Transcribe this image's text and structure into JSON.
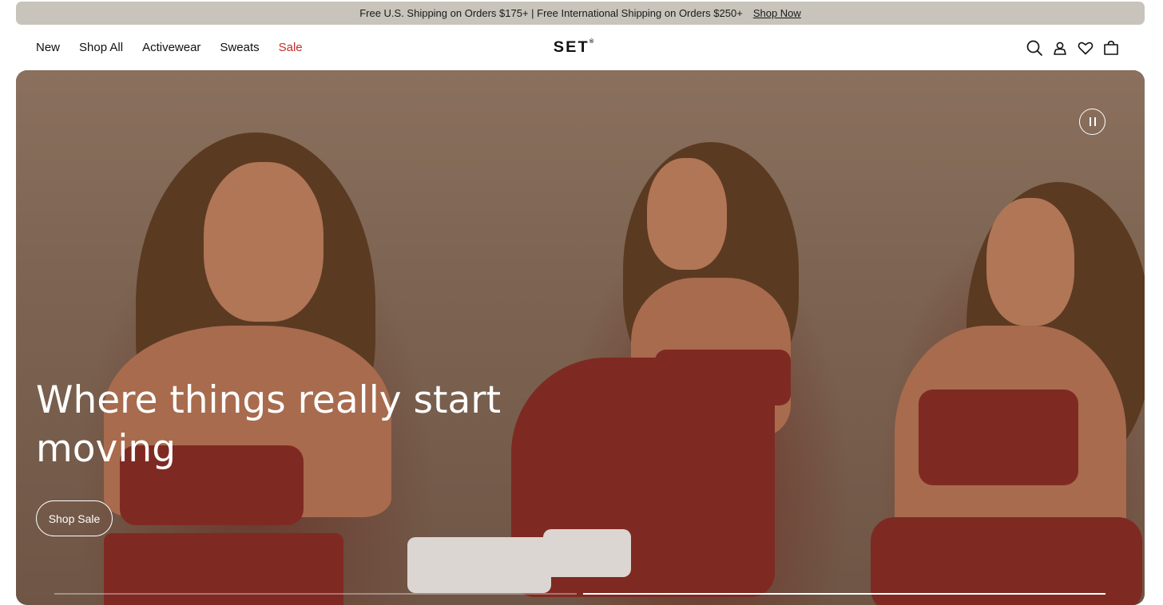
{
  "announcement": {
    "message": "Free U.S. Shipping on Orders $175+ | Free International Shipping on Orders $250+",
    "link_label": "Shop Now"
  },
  "nav": {
    "items": [
      {
        "label": "New"
      },
      {
        "label": "Shop All"
      },
      {
        "label": "Activewear"
      },
      {
        "label": "Sweats"
      },
      {
        "label": "Sale",
        "accent": "#c0302a"
      }
    ]
  },
  "brand": {
    "logo": "SET",
    "mark": "®"
  },
  "header_icons": [
    "search-icon",
    "account-icon",
    "wishlist-heart-icon",
    "shopping-bag-icon"
  ],
  "hero": {
    "headline": "Where things really start moving",
    "cta_label": "Shop Sale",
    "pause_icon": "pause-icon",
    "slides_total": 2,
    "active_slide": 2
  },
  "colors": {
    "announcement_bg": "#c9c4bb",
    "sale_accent": "#c0302a",
    "hero_bg": "#7e6451"
  }
}
